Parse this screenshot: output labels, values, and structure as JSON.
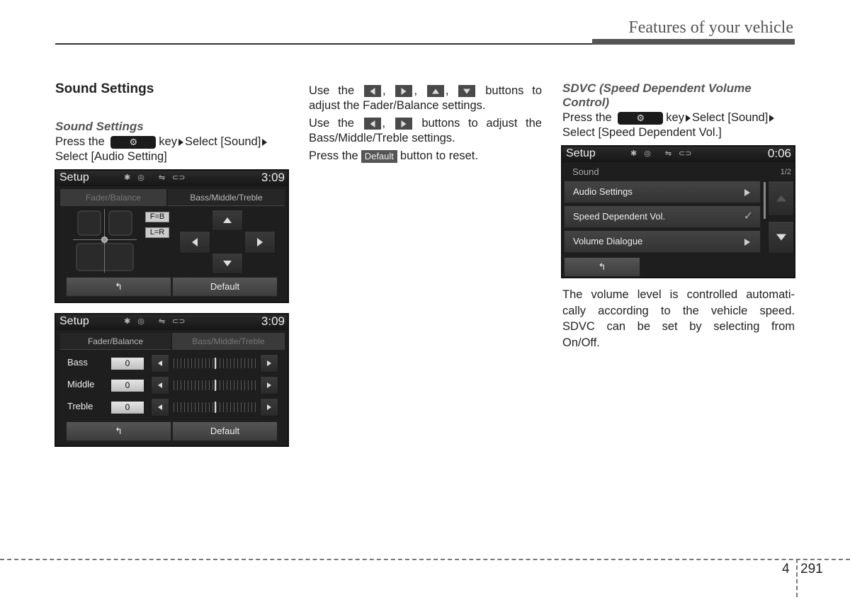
{
  "header": {
    "section_title": "Features of your vehicle"
  },
  "col1": {
    "heading": "Sound Settings",
    "subheading": "Sound Settings",
    "line1_a": "Press the",
    "key_icon": "gear-icon",
    "line1_b": "key",
    "line1_c": "Select [Sound]",
    "line2": "Select [Audio Setting]"
  },
  "screen1": {
    "title": "Setup",
    "clock": "3:09",
    "status_icons": [
      "bluetooth-icon",
      "disc-icon",
      "usb-icon",
      "aux-icon"
    ],
    "tabs": [
      {
        "label": "Fader/Balance",
        "active": true
      },
      {
        "label": "Bass/Middle/Treble",
        "active": false
      }
    ],
    "chips": [
      "F=B",
      "L=R"
    ],
    "back_label": "back-arrow-icon",
    "default_label": "Default"
  },
  "screen2": {
    "title": "Setup",
    "clock": "3:09",
    "tabs": [
      {
        "label": "Fader/Balance",
        "active": false
      },
      {
        "label": "Bass/Middle/Treble",
        "active": true
      }
    ],
    "rows": [
      {
        "label": "Bass",
        "value": "0",
        "level": 0.5
      },
      {
        "label": "Middle",
        "value": "0",
        "level": 0.5
      },
      {
        "label": "Treble",
        "value": "0",
        "level": 0.5
      }
    ],
    "default_label": "Default"
  },
  "col2": {
    "p1_a": "Use the",
    "p1_b": "buttons to",
    "p1_c": "adjust the Fader/Balance settings.",
    "p2_a": "Use the",
    "p2_b": "buttons to adjust the",
    "p2_c": "Bass/Middle/Treble settings.",
    "p3_a": "Press the",
    "p3_btn": "Default",
    "p3_b": "button to reset."
  },
  "col3": {
    "subheading_1": "SDVC (Speed Dependent Volume",
    "subheading_2": "Control)",
    "line1_a": "Press the",
    "line1_b": "key",
    "line1_c": "Select [Sound]",
    "line2": "Select [Speed Dependent Vol.]",
    "body_1": "The volume level is controlled automati-",
    "body_2": "cally according to the vehicle speed.",
    "body_3": "SDVC can be set by selecting from",
    "body_4": "On/Off."
  },
  "screen3": {
    "title": "Setup",
    "clock": "0:06",
    "section": "Sound",
    "page": "1/2",
    "items": [
      {
        "label": "Audio Settings",
        "indicator": "arrow-right"
      },
      {
        "label": "Speed Dependent Vol.",
        "indicator": "check"
      },
      {
        "label": "Volume Dialogue",
        "indicator": "arrow-right"
      }
    ]
  },
  "footer": {
    "chapter": "4",
    "page": "291"
  }
}
